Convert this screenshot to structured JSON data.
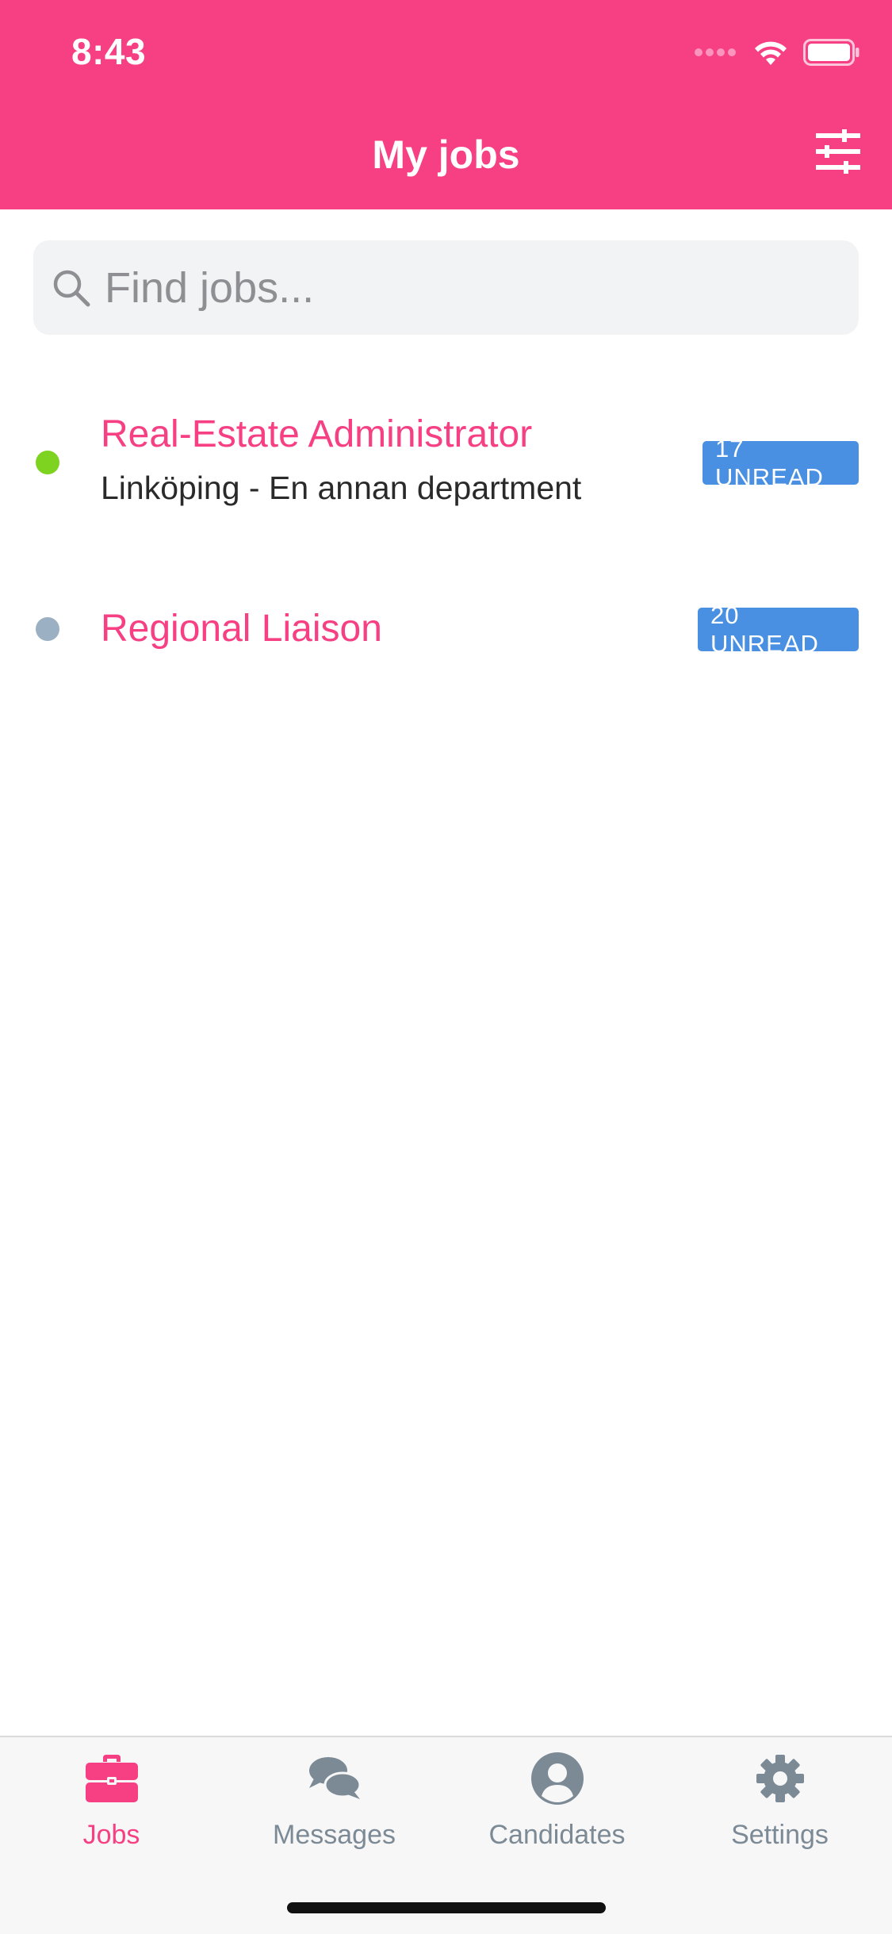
{
  "status_bar": {
    "time": "8:43"
  },
  "header": {
    "title": "My jobs",
    "filter_icon": "sliders-icon"
  },
  "search": {
    "placeholder": "Find jobs...",
    "value": ""
  },
  "jobs": [
    {
      "title": "Real-Estate Administrator",
      "subtitle": "Linköping - En annan department",
      "badge": "17 UNREAD",
      "status_color": "#7ED321"
    },
    {
      "title": "Regional Liaison",
      "badge": "20 UNREAD",
      "status_color": "#9BB0C2"
    }
  ],
  "tabs": [
    {
      "label": "Jobs",
      "icon": "briefcase-icon",
      "active": true
    },
    {
      "label": "Messages",
      "icon": "chat-bubbles-icon",
      "active": false
    },
    {
      "label": "Candidates",
      "icon": "user-circle-icon",
      "active": false
    },
    {
      "label": "Settings",
      "icon": "gear-icon",
      "active": false
    }
  ],
  "colors": {
    "brand": "#F73F83",
    "badge": "#4A90E2",
    "tab_inactive": "#7C8A96"
  }
}
